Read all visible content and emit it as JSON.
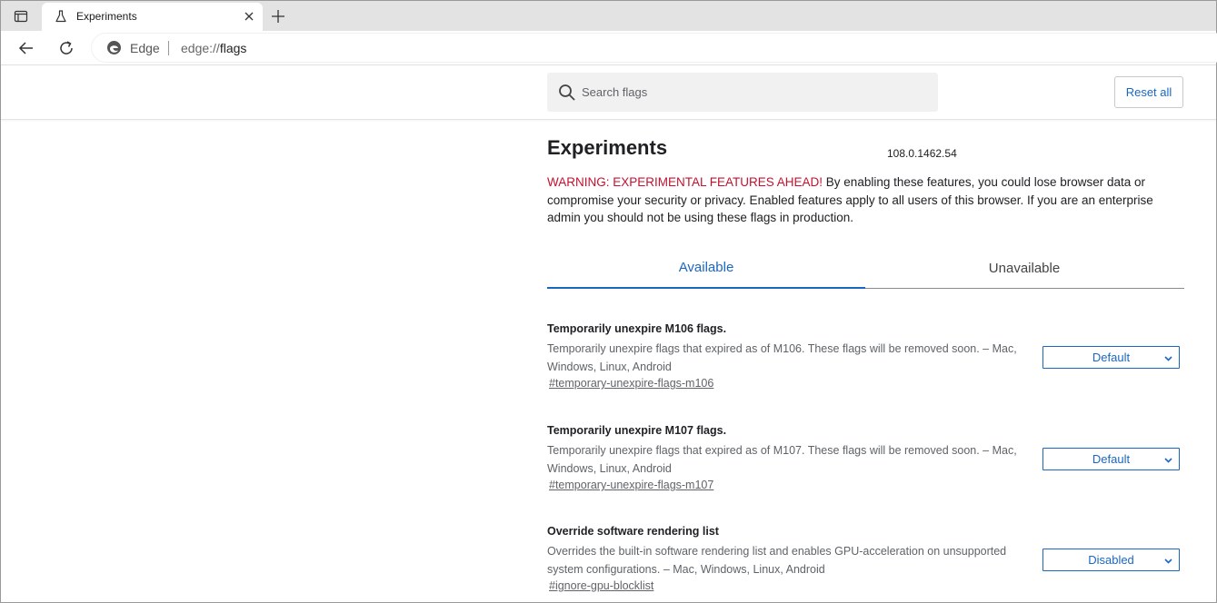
{
  "browser": {
    "tab": {
      "title": "Experiments"
    },
    "site_name": "Edge",
    "url_scheme": "edge://",
    "url_path": "flags"
  },
  "flags_page": {
    "search": {
      "placeholder": "Search flags",
      "value": ""
    },
    "reset_label": "Reset all",
    "title": "Experiments",
    "version": "108.0.1462.54",
    "warning_strong": "WARNING: EXPERIMENTAL FEATURES AHEAD!",
    "warning_text": " By enabling these features, you could lose browser data or compromise your security or privacy. Enabled features apply to all users of this browser. If you are an enterprise admin you should not be using these flags in production.",
    "tabs": [
      {
        "label": "Available",
        "selected": true
      },
      {
        "label": "Unavailable",
        "selected": false
      }
    ],
    "flags": [
      {
        "name": "Temporarily unexpire M106 flags.",
        "description": "Temporarily unexpire flags that expired as of M106. These flags will be removed soon. – Mac, Windows, Linux, Android",
        "link": "#temporary-unexpire-flags-m106",
        "value": "Default"
      },
      {
        "name": "Temporarily unexpire M107 flags.",
        "description": "Temporarily unexpire flags that expired as of M107. These flags will be removed soon. – Mac, Windows, Linux, Android",
        "link": "#temporary-unexpire-flags-m107",
        "value": "Default"
      },
      {
        "name": "Override software rendering list",
        "description": "Overrides the built-in software rendering list and enables GPU-acceleration on unsupported system configurations. – Mac, Windows, Linux, Android",
        "link": "#ignore-gpu-blocklist",
        "value": "Disabled"
      }
    ]
  },
  "colors": {
    "accent": "#1a67c2",
    "warning": "#c5112e",
    "tabstrip": "#e3e3e3"
  },
  "icons": {
    "tab_actions": "tab-actions-icon",
    "favicon": "flask-icon",
    "close": "close-icon",
    "new_tab": "plus-icon",
    "back": "back-arrow-icon",
    "reload": "reload-icon",
    "edge": "edge-logo-icon",
    "search": "search-icon",
    "select": "chevron-down-icon"
  }
}
